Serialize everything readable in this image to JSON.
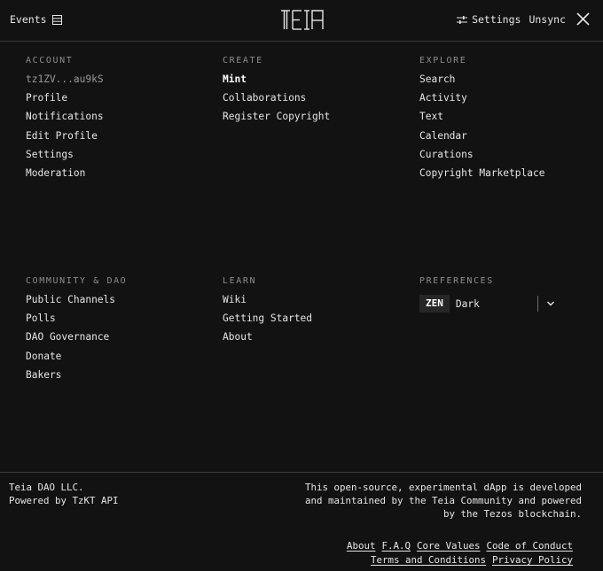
{
  "header": {
    "events_label": "Events",
    "logo_text": "TEIA",
    "settings_label": "Settings",
    "unsync_label": "Unsync"
  },
  "account": {
    "title": "ACCOUNT",
    "address": "tz1ZV...au9kS",
    "items": [
      "Profile",
      "Notifications",
      "Edit Profile",
      "Settings",
      "Moderation"
    ]
  },
  "create": {
    "title": "CREATE",
    "items": [
      "Mint",
      "Collaborations",
      "Register Copyright"
    ]
  },
  "explore": {
    "title": "EXPLORE",
    "items": [
      "Search",
      "Activity",
      "Text",
      "Calendar",
      "Curations",
      "Copyright Marketplace"
    ]
  },
  "community": {
    "title": "COMMUNITY & DAO",
    "items": [
      "Public Channels",
      "Polls",
      "DAO Governance",
      "Donate",
      "Bakers"
    ]
  },
  "learn": {
    "title": "LEARN",
    "items": [
      "Wiki",
      "Getting Started",
      "About"
    ]
  },
  "preferences": {
    "title": "PREFERENCES",
    "zen_label": "ZEN",
    "theme_value": "Dark"
  },
  "footer": {
    "company": "Teia DAO LLC.",
    "powered": "Powered by TzKT API",
    "description": "This open-source, experimental dApp is developed and maintained by the Teia Community and powered by the Tezos blockchain.",
    "links_row1": [
      "About",
      "F.A.Q",
      "Core Values",
      "Code of Conduct"
    ],
    "links_row2": [
      "Terms and Conditions",
      "Privacy Policy"
    ]
  },
  "colors": {
    "background": "#121212",
    "text": "#e6e6e6",
    "muted": "#8d8d8d",
    "divider": "#3a3a3a"
  }
}
